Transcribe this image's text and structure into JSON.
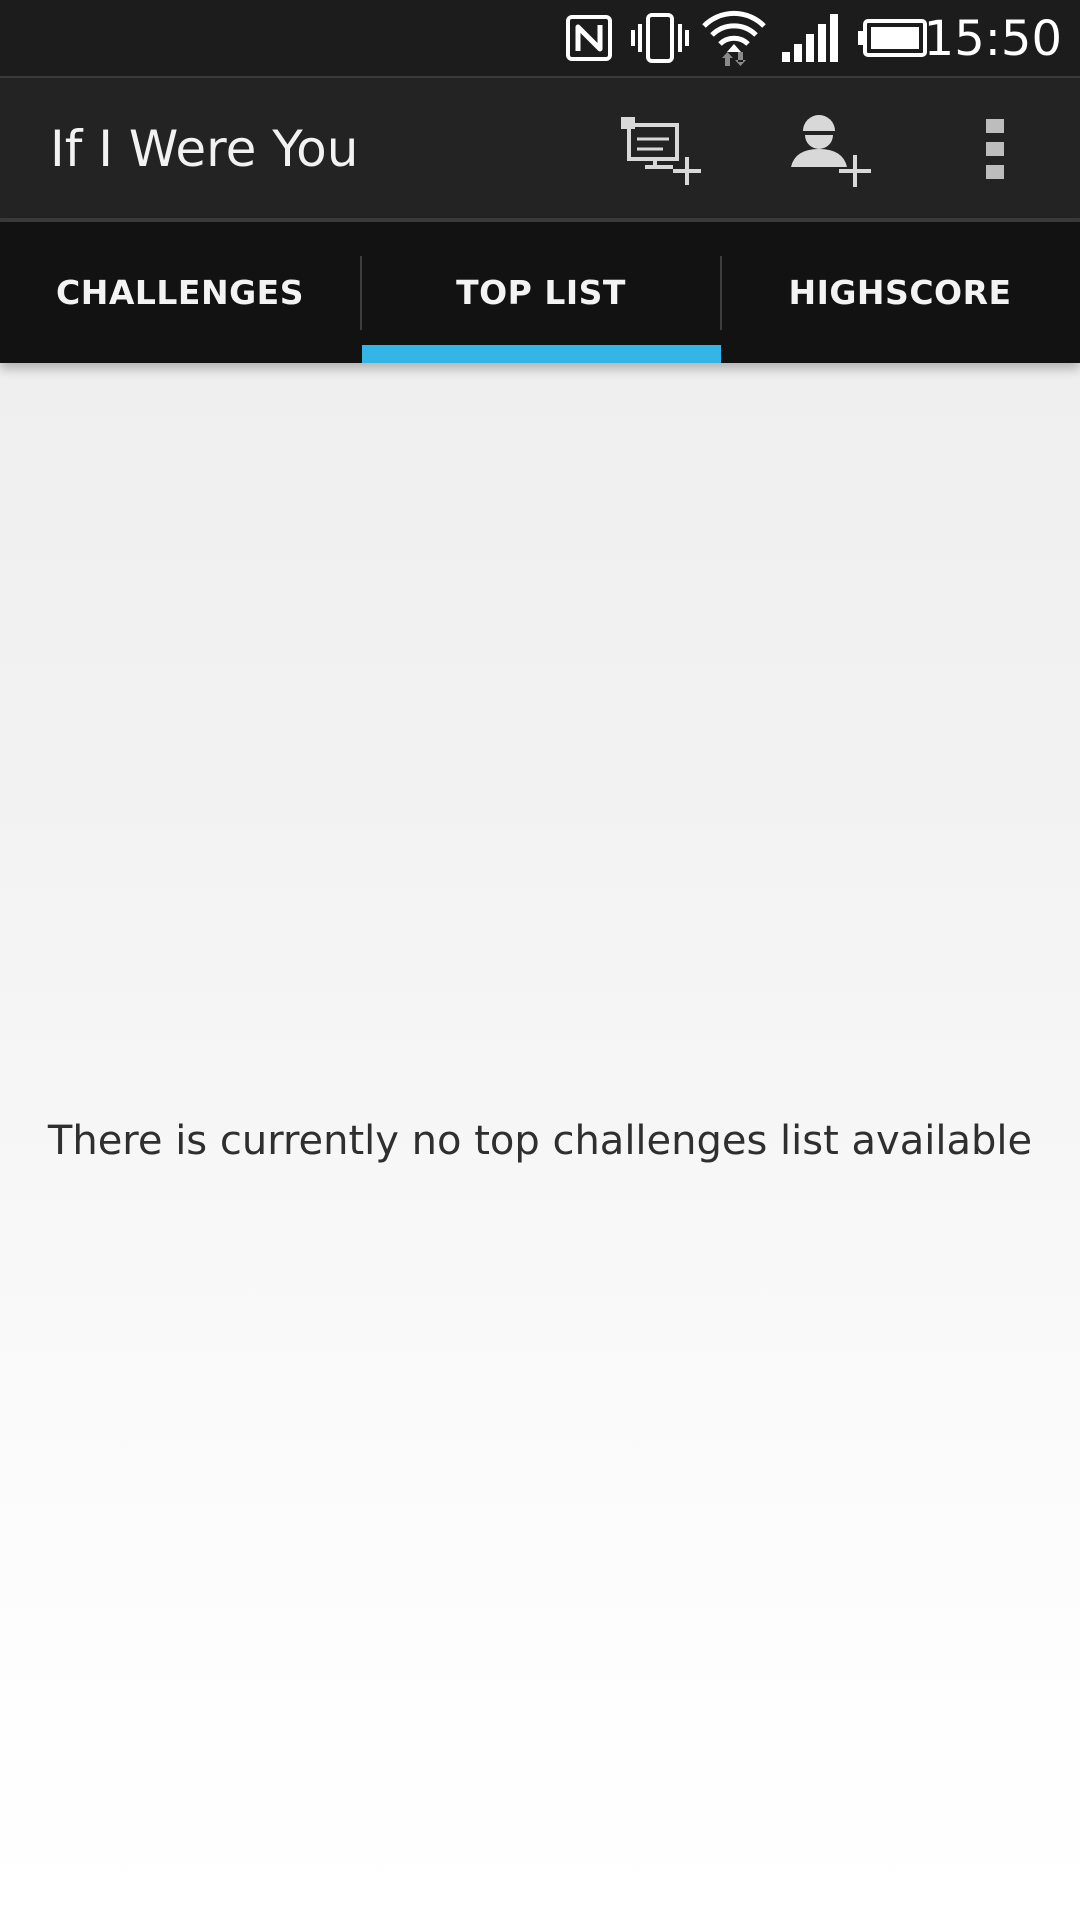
{
  "status_bar": {
    "time": "15:50",
    "icons": [
      "nfc-icon",
      "vibrate-icon",
      "wifi-icon",
      "signal-icon",
      "battery-icon"
    ]
  },
  "action_bar": {
    "title": "If I Were You",
    "actions": [
      "add-challenge-icon",
      "add-friend-icon",
      "overflow-menu-icon"
    ]
  },
  "tabs": [
    {
      "label": "CHALLENGES",
      "selected": false
    },
    {
      "label": "TOP LIST",
      "selected": true
    },
    {
      "label": "HIGHSCORE",
      "selected": false
    }
  ],
  "content": {
    "empty_message": "There is currently no top challenges list available"
  },
  "colors": {
    "accent": "#33b5e5",
    "action_bar": "#232323",
    "tab_bar": "#121212",
    "status_bar": "#1c1c1c"
  }
}
